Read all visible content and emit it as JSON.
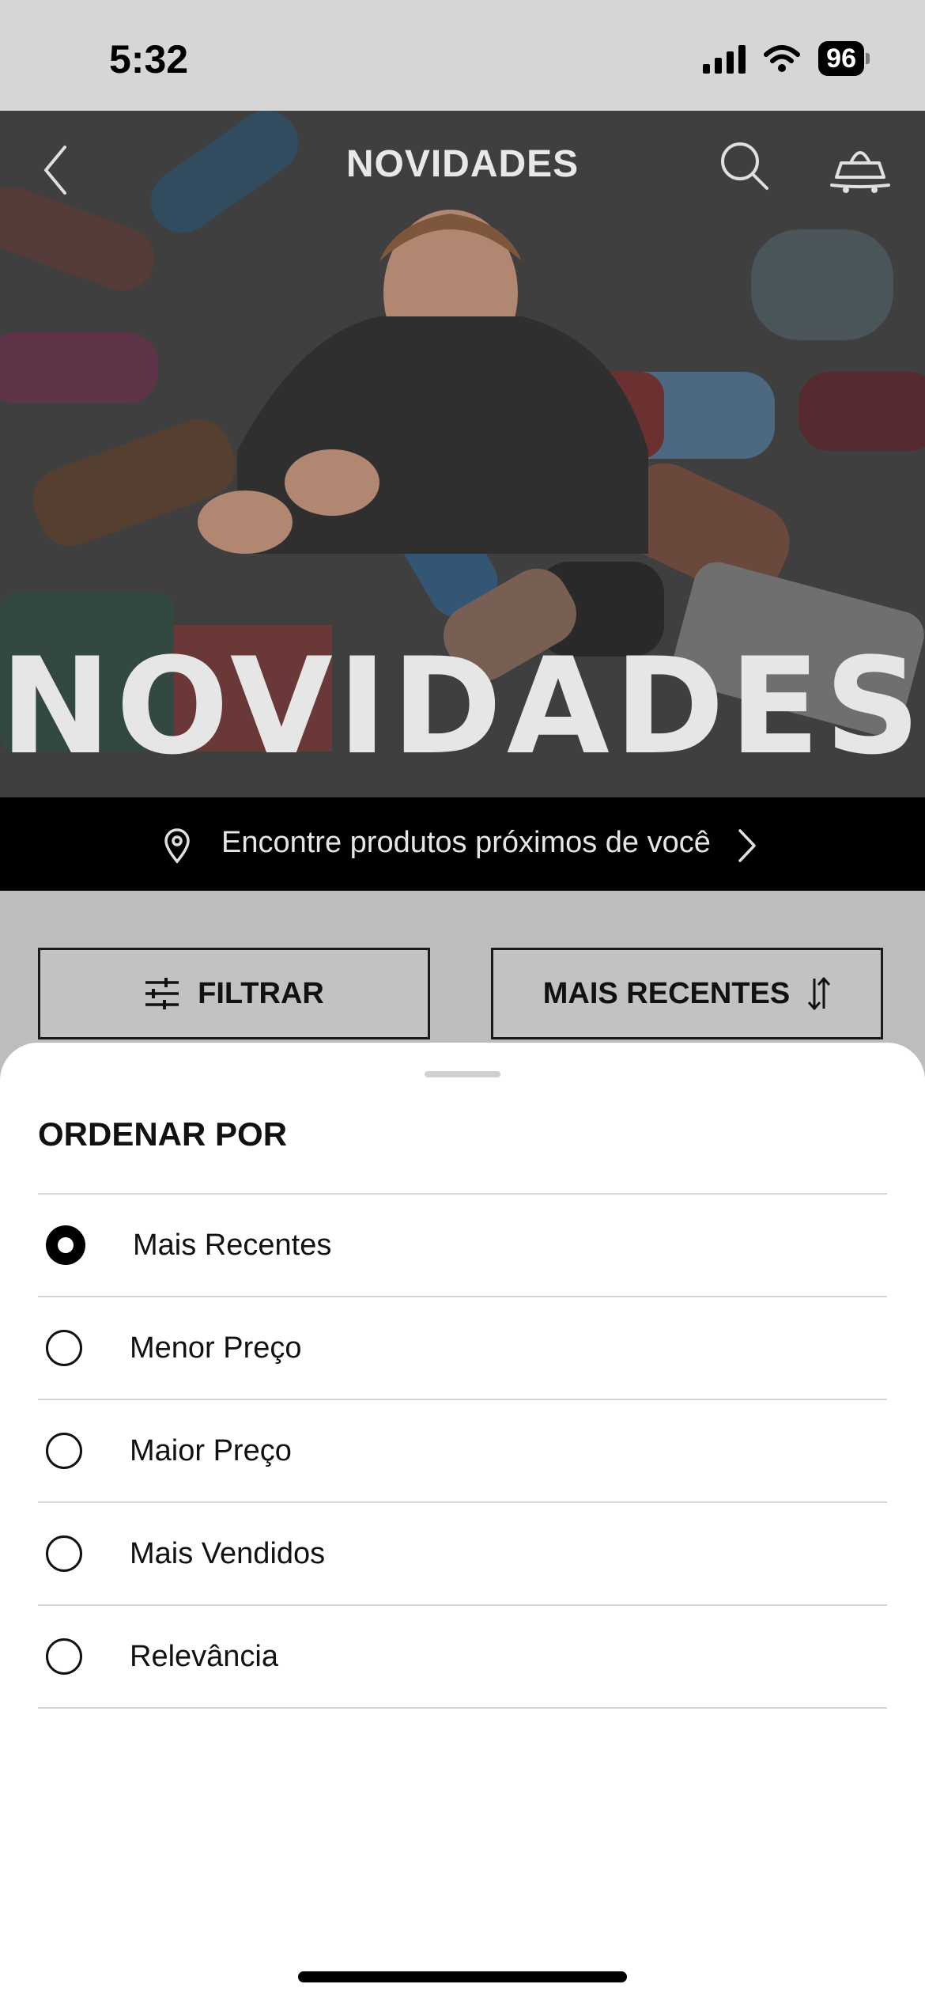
{
  "status_bar": {
    "time": "5:32",
    "battery": "96"
  },
  "header": {
    "title": "NOVIDADES"
  },
  "hero": {
    "headline": "NOVIDADES"
  },
  "location_bar": {
    "text": "Encontre produtos próximos de você"
  },
  "actions": {
    "filter_label": "FILTRAR",
    "sort_label": "MAIS RECENTES"
  },
  "sort_sheet": {
    "title": "ORDENAR POR",
    "selected": "Mais Recentes",
    "options": [
      {
        "label": "Mais Recentes"
      },
      {
        "label": "Menor Preço"
      },
      {
        "label": "Maior Preço"
      },
      {
        "label": "Mais Vendidos"
      },
      {
        "label": "Relevância"
      }
    ]
  }
}
